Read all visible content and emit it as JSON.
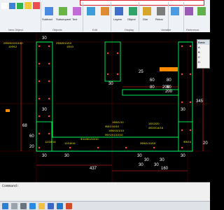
{
  "ribbon": {
    "search_placeholder": "",
    "groups": [
      {
        "label": "New Object"
      },
      {
        "label": "Objects"
      },
      {
        "label": "Edit"
      },
      {
        "label": "Display"
      },
      {
        "label": "Variable"
      },
      {
        "label": "Reference"
      }
    ],
    "buttons": [
      {
        "label": "Subtract"
      },
      {
        "label": "Subsequent"
      },
      {
        "label": "Text"
      },
      {
        "label": "Layers"
      },
      {
        "label": "Object"
      },
      {
        "label": "Dim"
      },
      {
        "label": "Rebar"
      }
    ]
  },
  "drawing": {
    "dimensions": [
      "30",
      "30",
      "30",
      "25",
      "60",
      "80",
      "80",
      "30",
      "30",
      "60",
      "200",
      "200",
      "345",
      "30",
      "30",
      "30",
      "30",
      "30",
      "437",
      "30",
      "30",
      "160",
      "20",
      "60",
      "68",
      "20"
    ],
    "rebar_labels": [
      "2Φ8/0/10/10",
      "2Φ8/0/10/10/10",
      "1Φ10",
      "10Φ12",
      "1Φ8/1/10",
      "Φ8/1/10/10",
      "1Φ8/10/1/10",
      "5Φ/10/1/10/10",
      "12/16/16",
      "Φ10/8/1/10/10",
      "1Φ12/20",
      "4Φ20/14/16",
      "3Φ8/1/10/16",
      "Φ8/16",
      "12/16/16"
    ]
  },
  "properties_panel": {
    "title": "Basic",
    "rows": [
      "A",
      "B",
      "C",
      "D"
    ]
  },
  "command_line": {
    "prompt": "Command:"
  },
  "taskbar": {
    "items": [
      "start",
      "search",
      "taskview",
      "edge",
      "explorer",
      "store",
      "mail",
      "app"
    ]
  },
  "colors": {
    "canvas_bg": "#000000",
    "wall_lines": "#00ff5a",
    "dimension": "#ff2a2a",
    "label_yellow": "#e8e800",
    "accent_red": "#d22"
  }
}
